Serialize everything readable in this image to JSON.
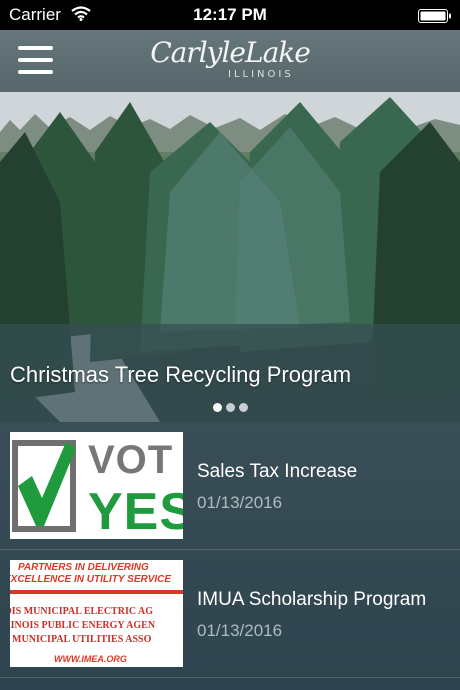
{
  "status_bar": {
    "carrier": "Carrier",
    "time": "12:17 PM"
  },
  "header": {
    "logo_script": "CarlyleLake",
    "logo_state": "ILLINOIS"
  },
  "hero": {
    "title": "Christmas Tree Recycling Program",
    "dot_count": 3,
    "active_dot": 0
  },
  "news": [
    {
      "title": "Sales Tax Increase",
      "date": "01/13/2016",
      "thumb": {
        "line1": "VOT",
        "line2": "YES"
      }
    },
    {
      "title": "IMUA Scholarship Program",
      "date": "01/13/2016",
      "thumb": {
        "line1": "PARTNERS IN DELIVERING",
        "line2": "EXCELLENCE IN UTILITY SERVICE",
        "line3": "OIS MUNICIPAL ELECTRIC AG",
        "line4": "LINOIS PUBLIC ENERGY AGEN",
        "line5": "S MUNICIPAL UTILITIES ASSO",
        "url": "WWW.IMEA.ORG"
      }
    }
  ],
  "colors": {
    "accent_green": "#1f9a3d",
    "imea_red": "#d63b28",
    "date_gray": "#aebcc0"
  }
}
